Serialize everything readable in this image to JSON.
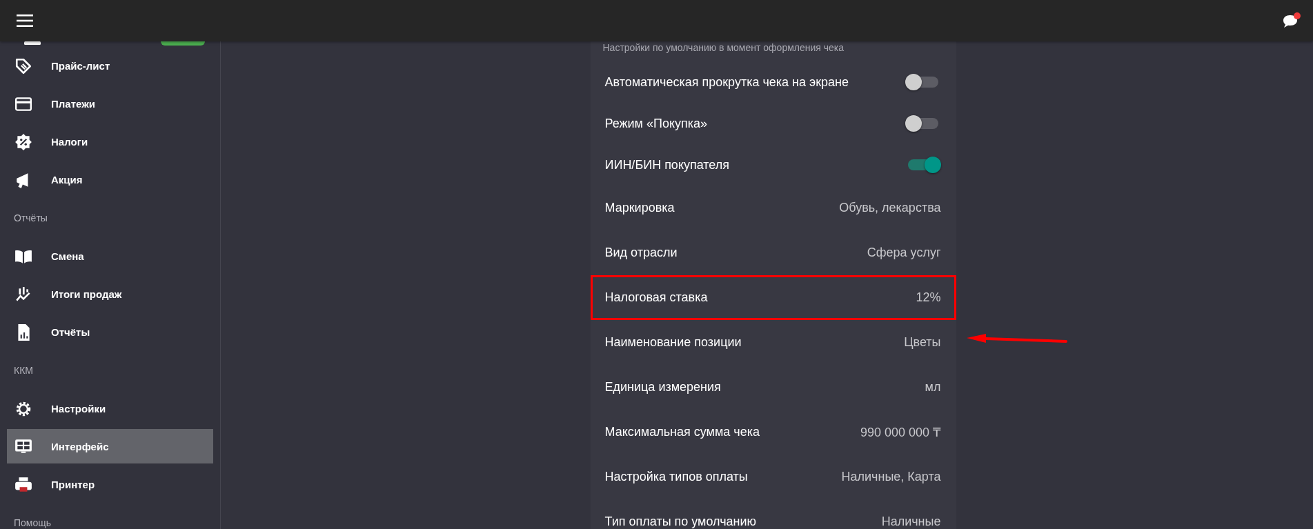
{
  "header": {
    "notification": true
  },
  "sidebar": [
    {
      "kind": "item",
      "label": "Прайс-лист",
      "selected": false
    },
    {
      "kind": "item",
      "label": "Платежи",
      "selected": false
    },
    {
      "kind": "item",
      "label": "Налоги",
      "selected": false
    },
    {
      "kind": "item",
      "label": "Акция",
      "selected": false
    },
    {
      "kind": "section",
      "label": "Отчёты"
    },
    {
      "kind": "item",
      "label": "Смена",
      "selected": false
    },
    {
      "kind": "item",
      "label": "Итоги продаж",
      "selected": false
    },
    {
      "kind": "item",
      "label": "Отчёты",
      "selected": false
    },
    {
      "kind": "section",
      "label": "ККМ"
    },
    {
      "kind": "item",
      "label": "Настройки",
      "selected": false
    },
    {
      "kind": "item",
      "label": "Интерфейс",
      "selected": true
    },
    {
      "kind": "item",
      "label": "Принтер",
      "selected": false
    },
    {
      "kind": "section",
      "label": "Помощь"
    }
  ],
  "settings": {
    "subtitle": "Настройки по умолчанию в момент оформления чека",
    "rows": [
      {
        "kind": "toggle",
        "label": "Автоматическая прокрутка чека на экране",
        "on": false,
        "highlighted": false
      },
      {
        "kind": "toggle",
        "label": "Режим «Покупка»",
        "on": false,
        "highlighted": false
      },
      {
        "kind": "toggle",
        "label": "ИИН/БИН покупателя",
        "on": true,
        "highlighted": false
      },
      {
        "kind": "value",
        "label": "Маркировка",
        "value": "Обувь, лекарства",
        "highlighted": false
      },
      {
        "kind": "value",
        "label": "Вид отрасли",
        "value": "Сфера услуг",
        "highlighted": false
      },
      {
        "kind": "value",
        "label": "Налоговая ставка",
        "value": "12%",
        "highlighted": true
      },
      {
        "kind": "value",
        "label": "Наименование позиции",
        "value": "Цветы",
        "highlighted": false
      },
      {
        "kind": "value",
        "label": "Единица измерения",
        "value": "мл",
        "highlighted": false
      },
      {
        "kind": "value",
        "label": "Максимальная сумма чека",
        "value": "990 000 000 ₸",
        "highlighted": false
      },
      {
        "kind": "value",
        "label": "Настройка типов оплаты",
        "value": "Наличные, Карта",
        "highlighted": false
      },
      {
        "kind": "value",
        "label": "Тип оплаты по умолчанию",
        "value": "Наличные",
        "highlighted": false
      }
    ]
  }
}
